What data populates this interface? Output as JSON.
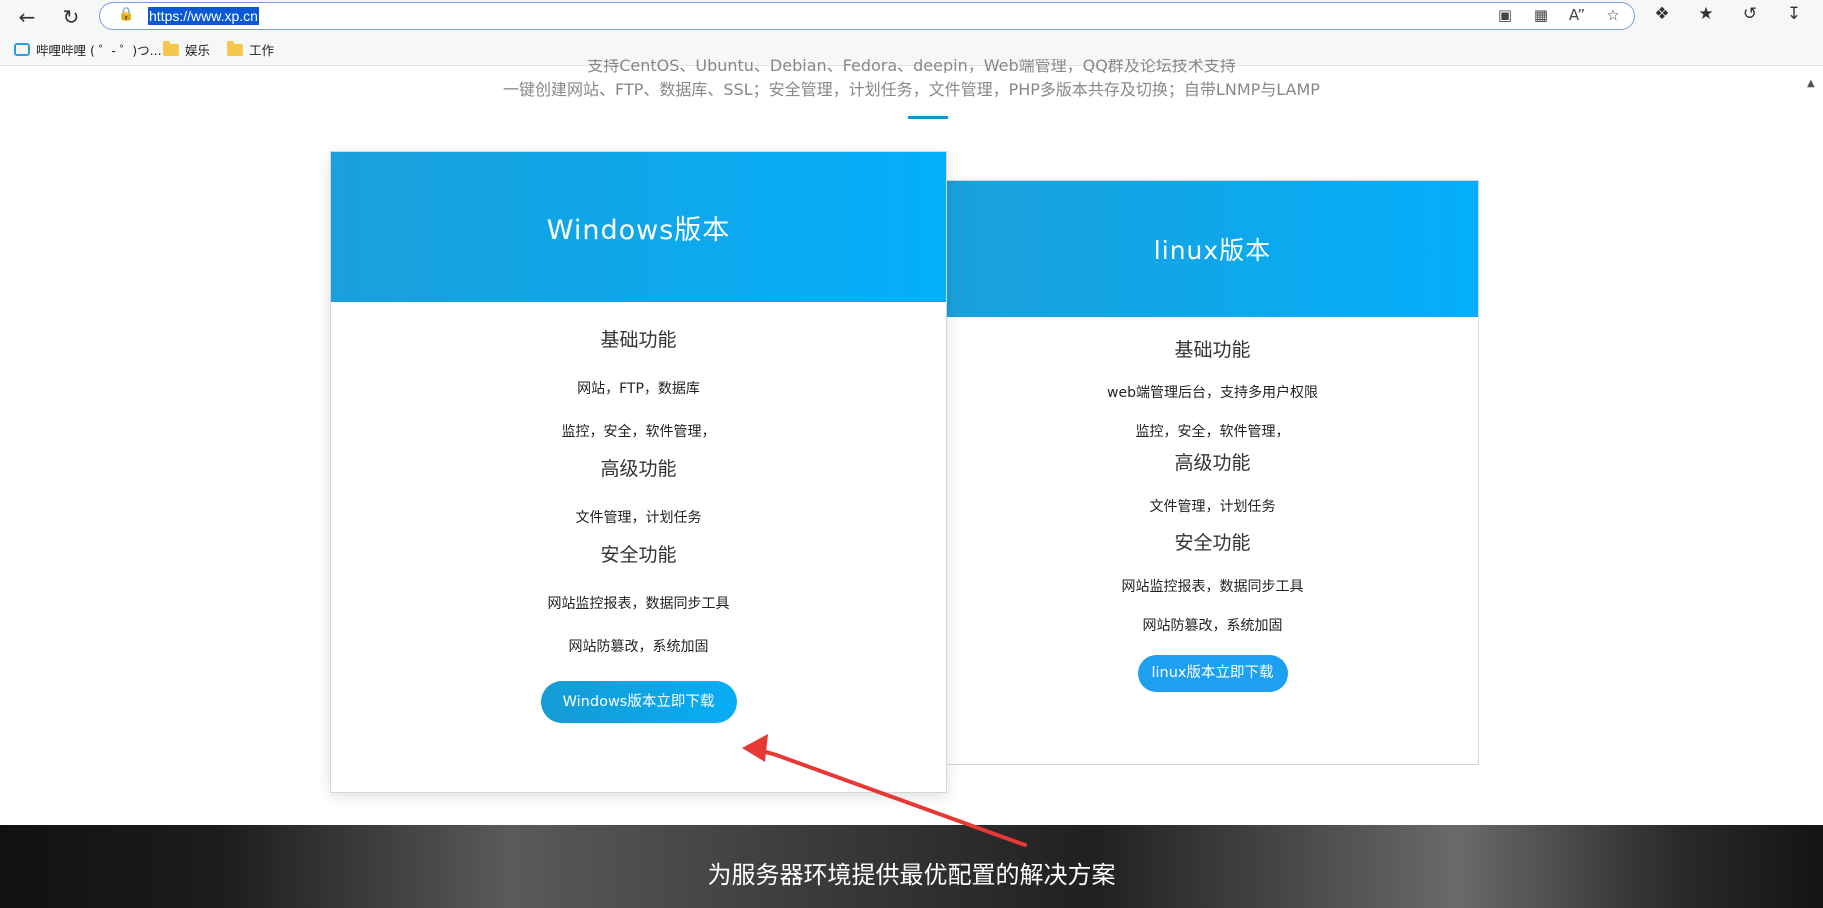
{
  "browser": {
    "url": "https://www.xp.cn",
    "bookmarks": [
      {
        "label": "哔哩哔哩 ( ゜- ゜)つ..."
      },
      {
        "label": "娱乐"
      },
      {
        "label": "工作"
      }
    ]
  },
  "intro": {
    "line1": "支持CentOS、Ubuntu、Debian、Fedora、deepin，Web端管理，QQ群及论坛技术支持",
    "line2": "一键创建网站、FTP、数据库、SSL；安全管理，计划任务，文件管理，PHP多版本共存及切换；自带LNMP与LAMP"
  },
  "cards": {
    "windows": {
      "title": "Windows版本",
      "basic_title": "基础功能",
      "basic_1": "网站，FTP，数据库",
      "basic_2": "监控，安全，软件管理，",
      "advanced_title": "高级功能",
      "advanced_1": "文件管理，计划任务",
      "security_title": "安全功能",
      "security_1": "网站监控报表，数据同步工具",
      "security_2": "网站防篡改，系统加固",
      "download_label": "Windows版本立即下载"
    },
    "linux": {
      "title": "linux版本",
      "basic_title": "基础功能",
      "basic_1": "web端管理后台，支持多用户权限",
      "basic_2": "监控，安全，软件管理，",
      "advanced_title": "高级功能",
      "advanced_1": "文件管理，计划任务",
      "security_title": "安全功能",
      "security_1": "网站监控报表，数据同步工具",
      "security_2": "网站防篡改，系统加固",
      "download_label": "linux版本立即下载"
    }
  },
  "banner": {
    "text": "为服务器环境提供最优配置的解决方案"
  },
  "colors": {
    "accent": "#1b8fd6",
    "card_header": "#04aefa",
    "annotation_arrow": "#e53935"
  }
}
